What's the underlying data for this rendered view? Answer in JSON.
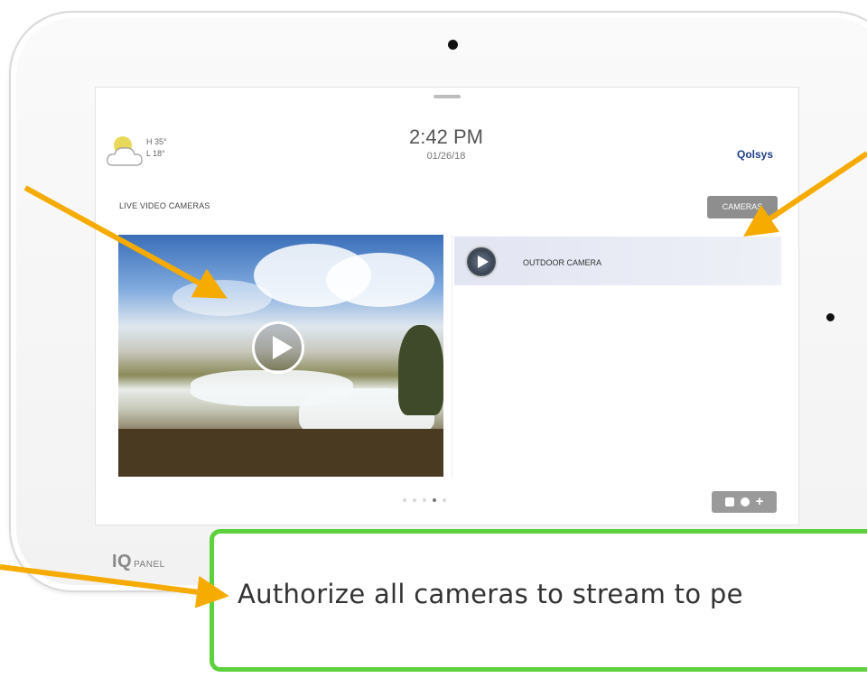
{
  "screen": {
    "weather": {
      "high": "H 35°",
      "low": "L 18°"
    },
    "clock": {
      "time": "2:42 PM",
      "date": "01/26/18"
    },
    "logo": "Qolsys",
    "section_title": "LIVE VIDEO CAMERAS",
    "cameras_button": "CAMERAS",
    "camera_list": [
      {
        "label": "OUTDOOR CAMERA"
      }
    ],
    "pager": {
      "pages": 5,
      "active": 4
    }
  },
  "device": {
    "brand_iq": "IQ",
    "brand_panel": "PANEL"
  },
  "callout": {
    "text": "Authorize all cameras to stream to pe"
  },
  "colors": {
    "arrow": "#f5ab00",
    "callout_border": "#5cd13c",
    "logo": "#1f3f8a"
  },
  "icons": [
    "sun-cloud-icon",
    "play-icon",
    "shield-icon",
    "fire-icon",
    "plus-icon"
  ]
}
